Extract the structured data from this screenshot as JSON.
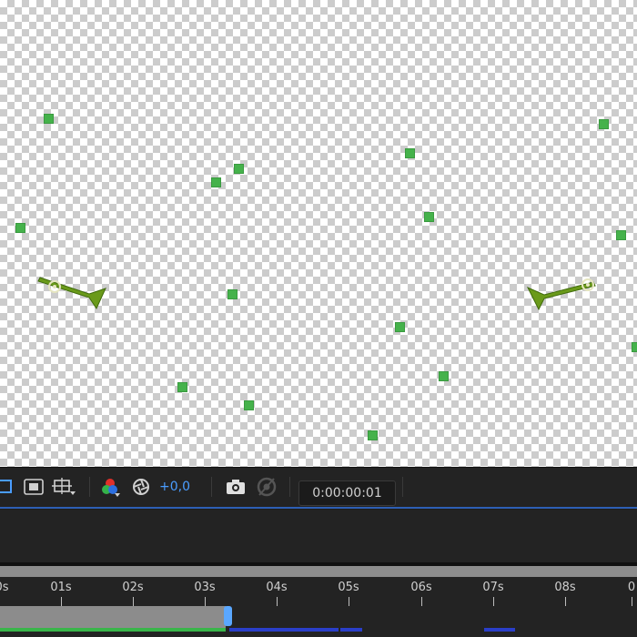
{
  "viewer": {
    "particle_color": "#45b24b",
    "emitter_color": "#6a9a1a"
  },
  "toolbar": {
    "icons": [
      "region-of-interest-icon",
      "transparency-grid-icon",
      "safe-margins-icon",
      "channel-color-icon",
      "reset-exposure-icon",
      "snapshot-icon",
      "show-snapshot-icon"
    ],
    "exposure_value": "+0,0",
    "timecode": "0:00:00:01",
    "accent_color": "#4a9dff"
  },
  "timeline": {
    "ruler_labels": [
      "0s",
      "01s",
      "02s",
      "03s",
      "04s",
      "05s",
      "06s",
      "07s",
      "08s",
      "0"
    ],
    "work_area_color": "#8c8c8c",
    "cti_color": "#5aa7ff",
    "cached_color": "#39b54a",
    "uncached_color": "#2a3ec8"
  }
}
